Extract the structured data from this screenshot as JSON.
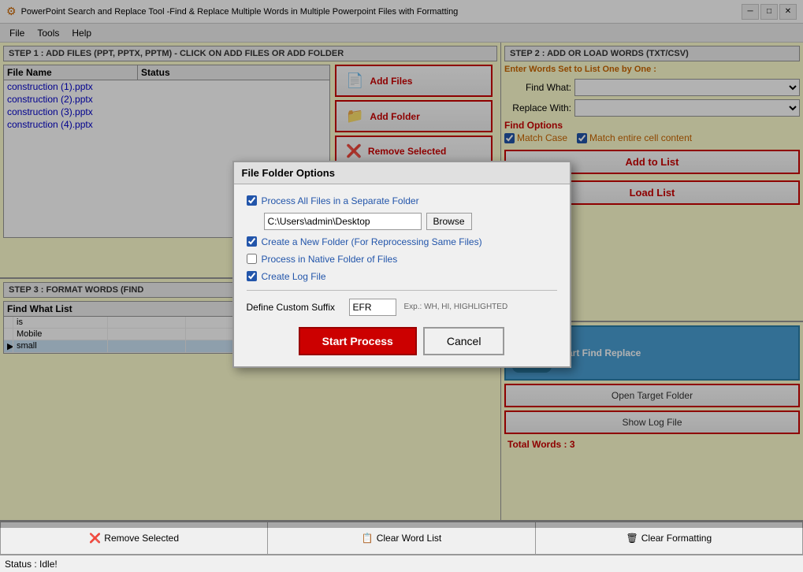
{
  "titleBar": {
    "text": "PowerPoint Search and Replace Tool -Find & Replace Multiple Words in Multiple Powerpoint Files with Formatting",
    "icon": "⚡",
    "minimize": "─",
    "maximize": "□",
    "close": "✕"
  },
  "menuBar": {
    "items": [
      "File",
      "Tools",
      "Help"
    ]
  },
  "step1": {
    "header": "STEP 1 : ADD FILES (PPT, PPTX, PPTM) - CLICK ON ADD FILES OR ADD FOLDER",
    "columns": [
      "File Name",
      "Status"
    ],
    "files": [
      {
        "name": "construction (1).pptx",
        "status": ""
      },
      {
        "name": "construction (2).pptx",
        "status": ""
      },
      {
        "name": "construction (3).pptx",
        "status": ""
      },
      {
        "name": "construction (4).pptx",
        "status": ""
      }
    ],
    "addFilesBtn": "Add Files",
    "addFolderBtn": "Add Folder",
    "removeSelectedBtn": "Remove Selected"
  },
  "step2": {
    "header": "STEP 2 : ADD OR LOAD WORDS (TXT/CSV)",
    "enterWordsLabel": "Enter Words Set to List One by One :",
    "findWhatLabel": "Find What:",
    "replaceWithLabel": "Replace With:",
    "findOptions": {
      "header": "Find Options",
      "matchCase": "Match Case",
      "matchCaseChecked": true,
      "matchEntireCell": "Match entire cell content",
      "matchEntireCellChecked": true
    },
    "addToListBtn": "Add to List",
    "loadListBtn": "Load List"
  },
  "step3": {
    "header": "STEP 3 : FORMAT WORDS (FIND",
    "columnHeaders": [
      "Find What List",
      "",
      "",
      "",
      "",
      ""
    ],
    "words": [
      {
        "arrow": "",
        "find": "is",
        "cols": [
          "",
          "",
          "",
          "",
          ""
        ]
      },
      {
        "arrow": "",
        "find": "Mobile",
        "cols": [
          "",
          "",
          "",
          "",
          ""
        ]
      },
      {
        "arrow": "▶",
        "find": "small",
        "cols": [
          "",
          "",
          "",
          "",
          ""
        ]
      }
    ]
  },
  "rightBottom": {
    "startFindReplaceBtn": "Start Find Replace",
    "openTargetFolderBtn": "Open Target Folder",
    "showLogFileBtn": "Show Log File",
    "totalWords": "Total Words : 3"
  },
  "bottomToolbar": {
    "removeSelectedBtn": "Remove Selected",
    "clearWordListBtn": "Clear Word List",
    "clearFormattingBtn": "Clear Formatting"
  },
  "statusBar": {
    "text": "Status :  Idle!"
  },
  "modal": {
    "title": "File Folder Options",
    "option1Label": "Process All Files in a Separate Folder",
    "option1Checked": true,
    "folderPath": "C:\\Users\\admin\\Desktop",
    "browseBtnLabel": "Browse",
    "option2Label": "Create a New Folder (For Reprocessing Same Files)",
    "option2Checked": true,
    "option3Label": "Process in Native Folder of Files",
    "option3Checked": false,
    "option4Label": "Create Log File",
    "option4Checked": true,
    "suffixLabel": "Define Custom Suffix",
    "suffixValue": "EFR",
    "suffixExample": "Exp.: WH, HI, HIGHLIGHTED",
    "startProcessBtn": "Start Process",
    "cancelBtn": "Cancel"
  }
}
